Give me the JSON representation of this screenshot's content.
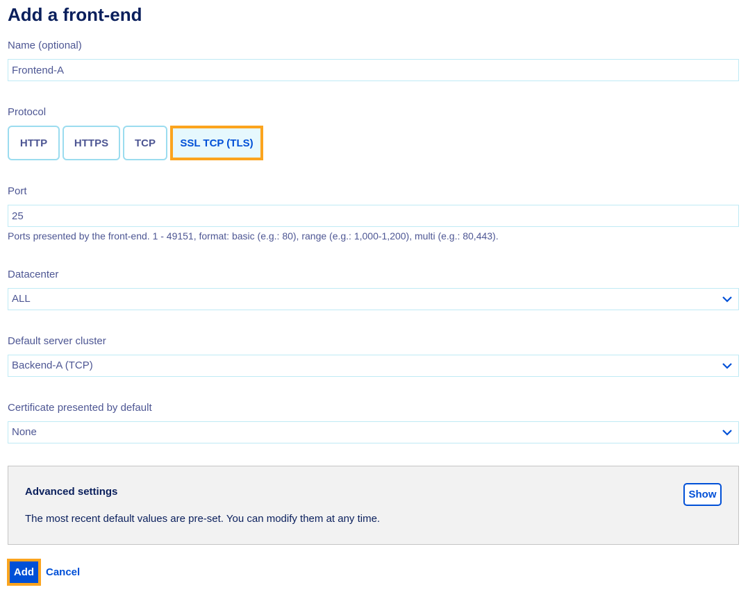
{
  "page": {
    "title": "Add a front-end"
  },
  "name": {
    "label": "Name (optional)",
    "value": "Frontend-A"
  },
  "protocol": {
    "label": "Protocol",
    "options": [
      "HTTP",
      "HTTPS",
      "TCP",
      "SSL TCP (TLS)"
    ],
    "selected": "SSL TCP (TLS)"
  },
  "port": {
    "label": "Port",
    "value": "25",
    "help": "Ports presented by the front-end. 1 - 49151, format: basic (e.g.: 80), range (e.g.: 1,000-1,200), multi (e.g.: 80,443)."
  },
  "datacenter": {
    "label": "Datacenter",
    "value": "ALL"
  },
  "cluster": {
    "label": "Default server cluster",
    "value": "Backend-A (TCP)"
  },
  "certificate": {
    "label": "Certificate presented by default",
    "value": "None"
  },
  "advanced": {
    "title": "Advanced settings",
    "description": "The most recent default values are pre-set. You can modify them at any time.",
    "show_label": "Show"
  },
  "actions": {
    "add_label": "Add",
    "cancel_label": "Cancel"
  },
  "colors": {
    "accent": "#0050d7",
    "highlight": "#fba41e",
    "border": "#bfeaf5",
    "text": "#4d5693",
    "heading": "#0a1f5c"
  },
  "icons": {
    "select": "chevron-down-icon"
  }
}
